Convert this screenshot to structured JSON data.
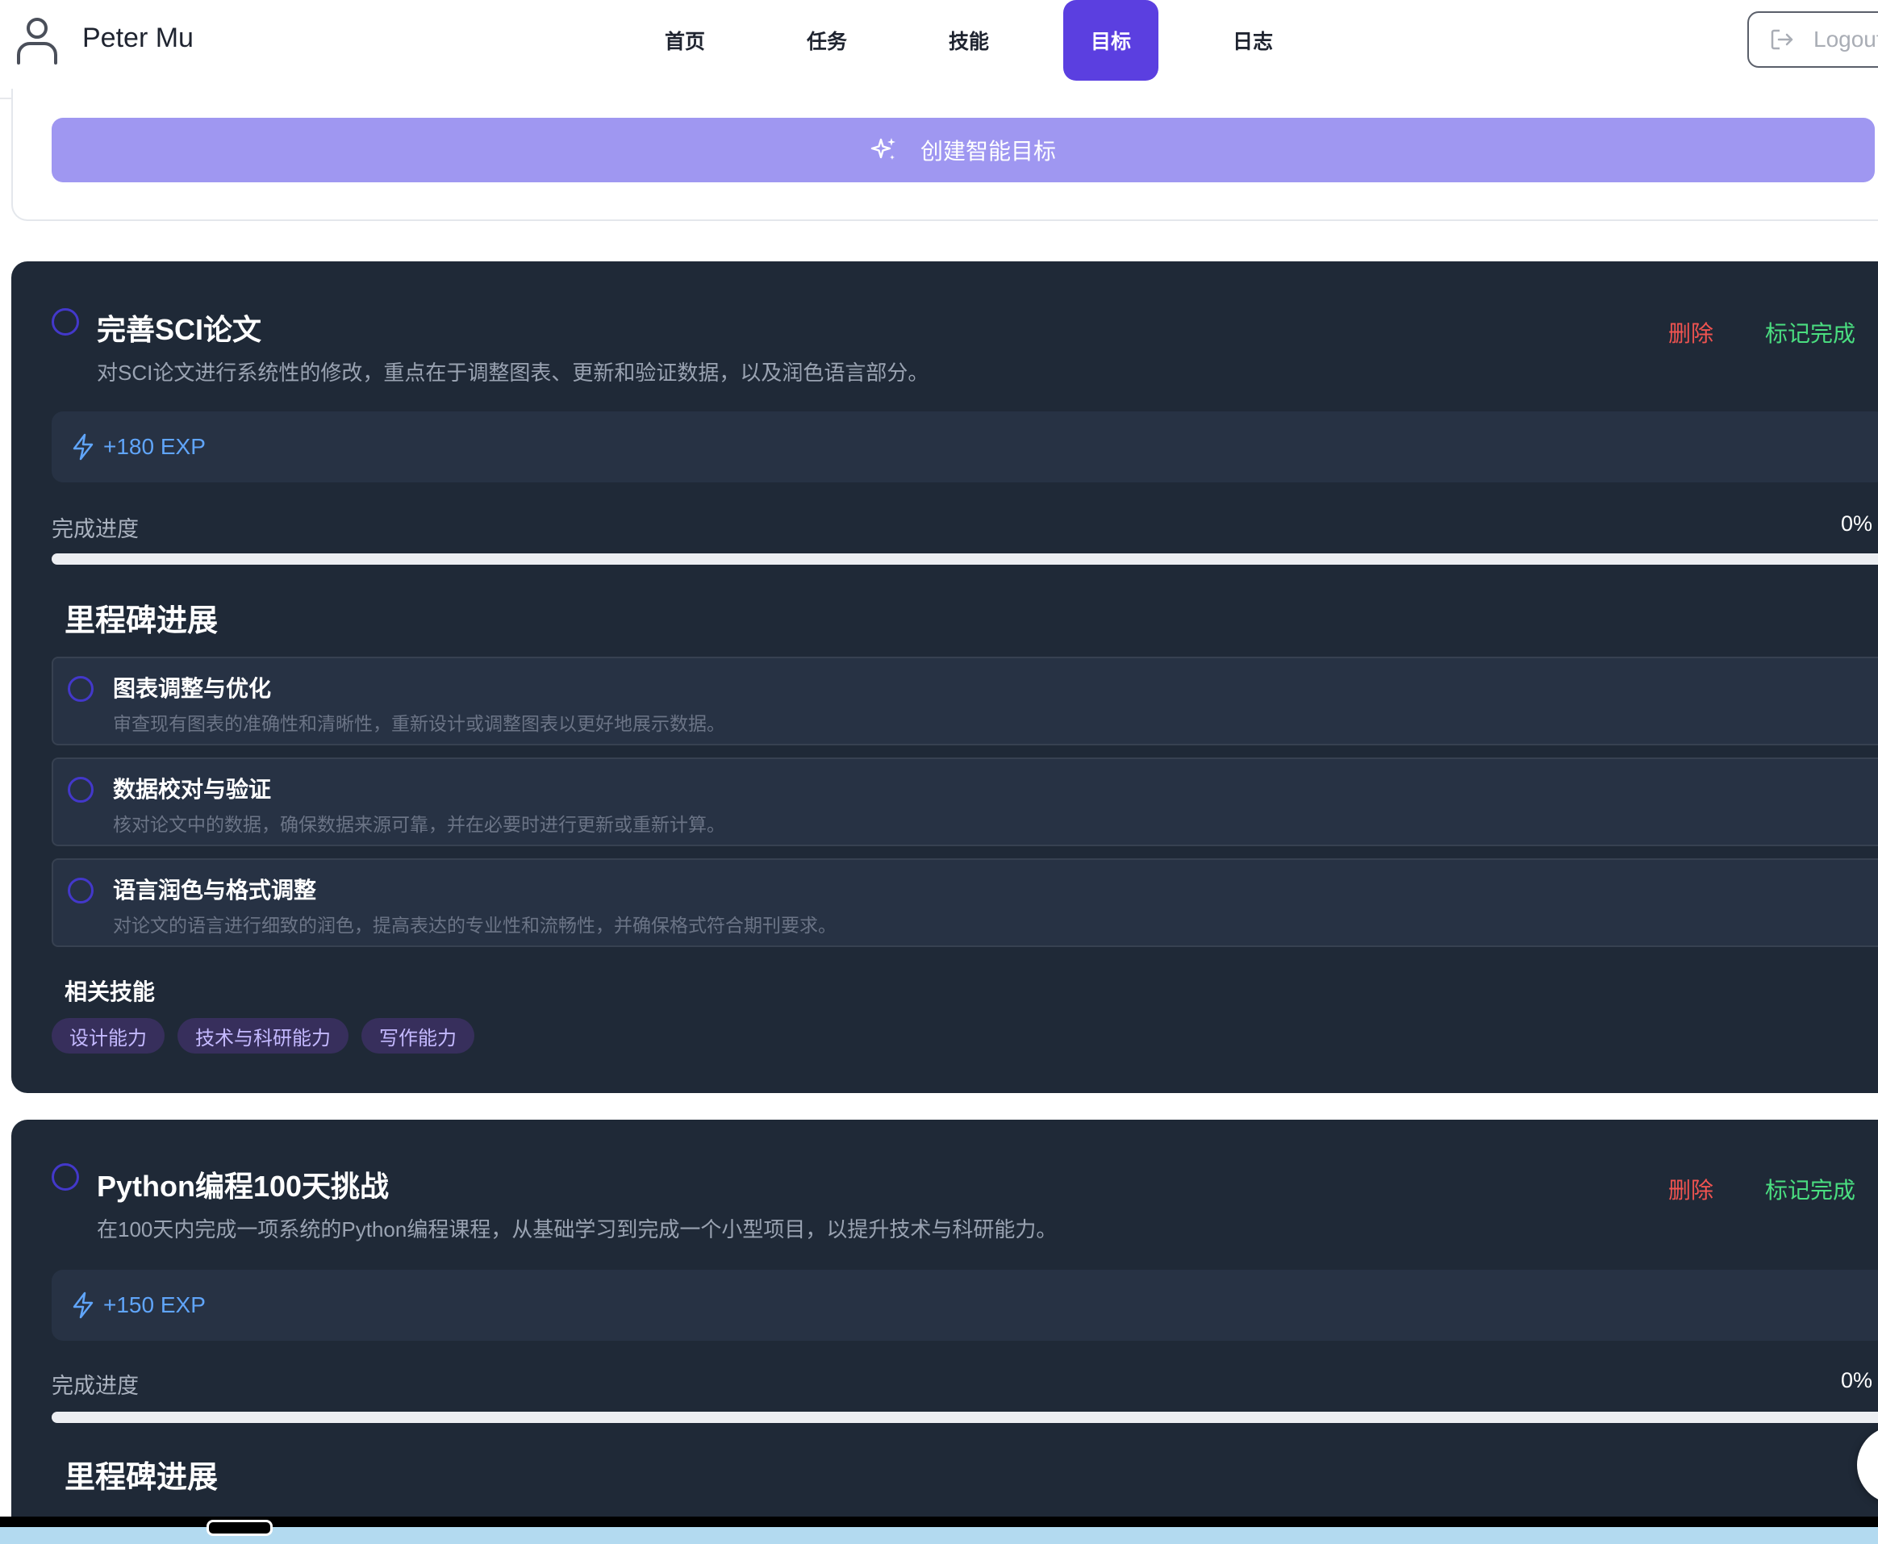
{
  "header": {
    "user_name": "Peter Mu",
    "nav": [
      {
        "label": "首页",
        "active": false
      },
      {
        "label": "任务",
        "active": false
      },
      {
        "label": "技能",
        "active": false
      },
      {
        "label": "目标",
        "active": true
      },
      {
        "label": "日志",
        "active": false
      }
    ],
    "logout_label": "Logout",
    "icons": {
      "avatar": "user-icon",
      "logout": "logout-icon"
    }
  },
  "create": {
    "label": "创建智能目标",
    "icon": "sparkle-icon"
  },
  "goals": [
    {
      "title": "完善SCI论文",
      "description": "对SCI论文进行系统性的修改，重点在于调整图表、更新和验证数据，以及润色语言部分。",
      "delete_label": "删除",
      "complete_label": "标记完成",
      "exp": "+180 EXP",
      "progress_label": "完成进度",
      "progress_text": "0%",
      "progress": 0,
      "milestones_heading": "里程碑进展",
      "milestones": [
        {
          "title": "图表调整与优化",
          "description": "审查现有图表的准确性和清晰性，重新设计或调整图表以更好地展示数据。"
        },
        {
          "title": "数据校对与验证",
          "description": "核对论文中的数据，确保数据来源可靠，并在必要时进行更新或重新计算。"
        },
        {
          "title": "语言润色与格式调整",
          "description": "对论文的语言进行细致的润色，提高表达的专业性和流畅性，并确保格式符合期刊要求。"
        }
      ],
      "skills_heading": "相关技能",
      "skills": [
        "设计能力",
        "技术与科研能力",
        "写作能力"
      ]
    },
    {
      "title": "Python编程100天挑战",
      "description": "在100天内完成一项系统的Python编程课程，从基础学习到完成一个小型项目，以提升技术与科研能力。",
      "delete_label": "删除",
      "complete_label": "标记完成",
      "exp": "+150 EXP",
      "progress_label": "完成进度",
      "progress_text": "0%",
      "progress": 0,
      "milestones_heading": "里程碑进展"
    }
  ],
  "colors": {
    "accent": "#5b3fe0",
    "create_button": "#9f97f1",
    "card_bg": "#1f2937",
    "delete": "#ef5350",
    "complete": "#4ade80",
    "exp": "#60a5fa"
  }
}
